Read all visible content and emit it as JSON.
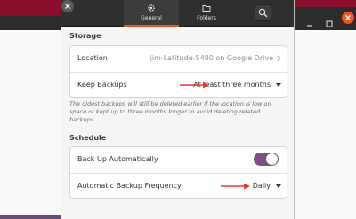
{
  "tabs": [
    {
      "label": "General",
      "icon": "gear-icon",
      "active": true
    },
    {
      "label": "Folders",
      "icon": "folder-icon",
      "active": false
    }
  ],
  "storage": {
    "title": "Storage",
    "location_label": "Location",
    "location_value": "jim-Latitude-5480 on Google Drive",
    "keep_label": "Keep Backups",
    "keep_value": "At least three months",
    "note": "The oldest backups will still be deleted earlier if the location is low on space or kept up to three months longer to avoid deleting related backups."
  },
  "schedule": {
    "title": "Schedule",
    "auto_label": "Back Up Automatically",
    "auto_enabled": true,
    "freq_label": "Automatic Backup Frequency",
    "freq_value": "Daily"
  },
  "colors": {
    "accent_orange": "#e95420",
    "toggle_purple": "#7d4f86",
    "annotation_arrow": "#e53935"
  },
  "window_controls": [
    "minimize-icon",
    "maximize-icon",
    "close-icon"
  ]
}
